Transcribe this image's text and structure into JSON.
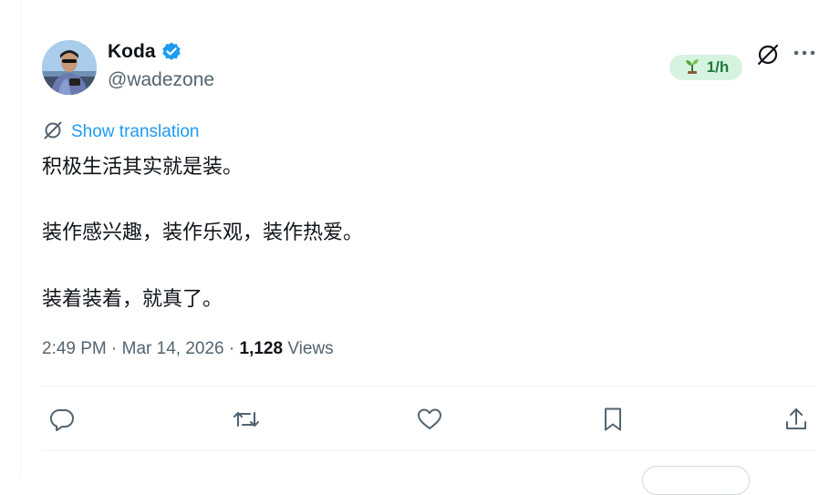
{
  "author": {
    "name": "Koda",
    "handle": "@wadezone"
  },
  "badge": {
    "label": "1/h",
    "icon": "sprout-icon"
  },
  "header_icons": [
    "translate-icon",
    "more-icon"
  ],
  "tweet": {
    "translate_label": "Show translation",
    "lines": [
      "积极生活其实就是装。",
      "装作感兴趣，装作乐观，装作热爱。",
      "装着装着，就真了。"
    ]
  },
  "meta": {
    "time": "2:49 PM",
    "date": "Mar 14, 2026",
    "separator": "·",
    "views_count": "1,128",
    "views_label": "Views"
  },
  "actions": [
    "reply-icon",
    "retweet-icon",
    "like-icon",
    "bookmark-icon",
    "share-icon"
  ],
  "colors": {
    "link": "#1d9bf0",
    "verified": "#1d9bf0",
    "secondary_text": "#536471",
    "badge_bg": "#d6f3df",
    "badge_text": "#1f7a3a"
  }
}
